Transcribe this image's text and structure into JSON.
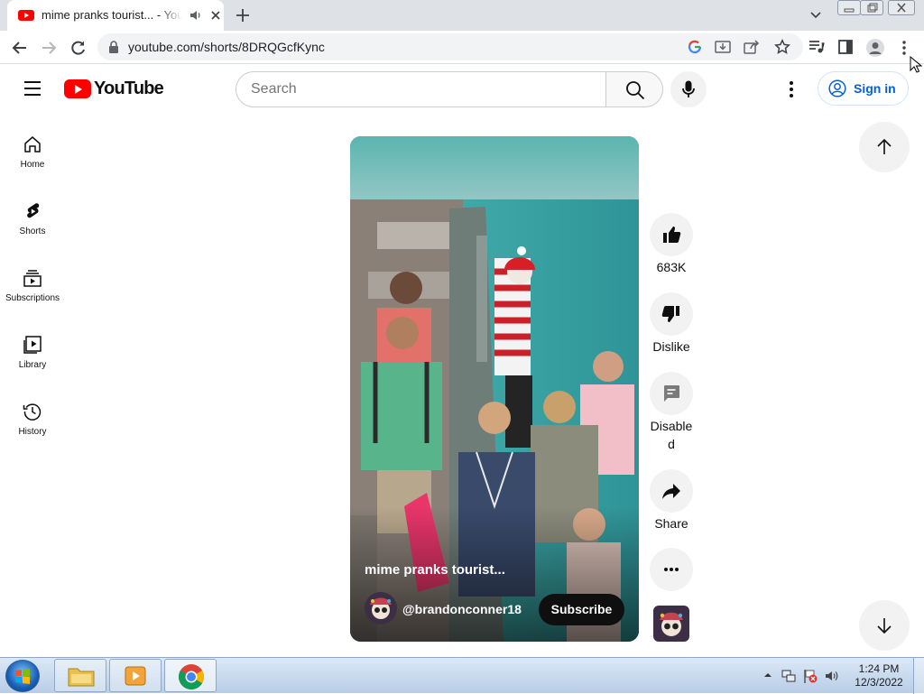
{
  "browser": {
    "tab_title": "mime pranks tourist... - YouTube",
    "url": "youtube.com/shorts/8DRQGcfKync"
  },
  "masthead": {
    "logo_text": "YouTube",
    "search_placeholder": "Search",
    "signin_label": "Sign in"
  },
  "sidebar": {
    "items": [
      {
        "label": "Home",
        "icon": "home-icon"
      },
      {
        "label": "Shorts",
        "icon": "shorts-icon"
      },
      {
        "label": "Subscriptions",
        "icon": "subscriptions-icon"
      },
      {
        "label": "Library",
        "icon": "library-icon"
      },
      {
        "label": "History",
        "icon": "history-icon"
      }
    ]
  },
  "short": {
    "title": "mime pranks tourist...",
    "channel": "@brandonconner18",
    "subscribe_label": "Subscribe"
  },
  "actions": {
    "likes": "683K",
    "dislike_label": "Dislike",
    "comments_label_line1": "Disable",
    "comments_label_line2": "d",
    "share_label": "Share"
  },
  "taskbar": {
    "time": "1:24 PM",
    "date": "12/3/2022"
  },
  "colors": {
    "youtube_red": "#ff0000",
    "link_blue": "#065fd4"
  }
}
